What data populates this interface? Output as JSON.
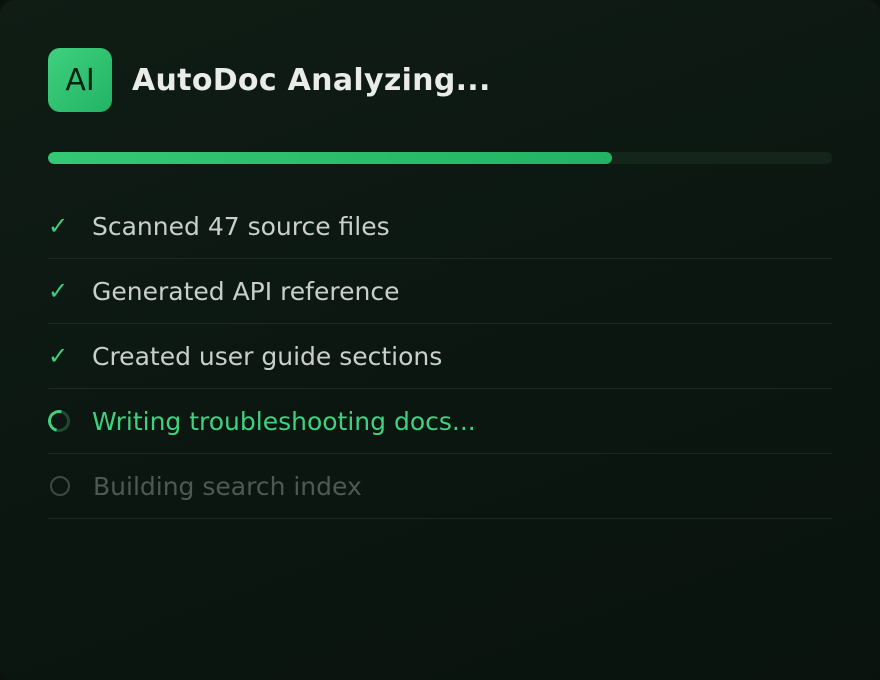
{
  "app": {
    "logo_text": "AI",
    "title": "AutoDoc Analyzing..."
  },
  "progress": {
    "fraction": 0.72
  },
  "colors": {
    "accent": "#3fd17f",
    "completed_text": "#c9cfcb",
    "pending_text": "#4c5a51"
  },
  "steps": [
    {
      "status": "done",
      "icon": "check-icon",
      "glyph": "✓",
      "label": "Scanned 47 source files"
    },
    {
      "status": "done",
      "icon": "check-icon",
      "glyph": "✓",
      "label": "Generated API reference"
    },
    {
      "status": "done",
      "icon": "check-icon",
      "glyph": "✓",
      "label": "Created user guide sections"
    },
    {
      "status": "active",
      "icon": "spinner-icon",
      "glyph": "",
      "label": "Writing troubleshooting docs..."
    },
    {
      "status": "pending",
      "icon": "empty-circle-icon",
      "glyph": "",
      "label": "Building search index"
    }
  ]
}
